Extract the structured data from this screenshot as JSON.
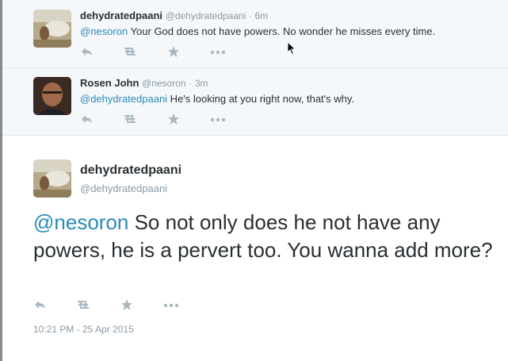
{
  "replies": [
    {
      "fullname": "dehydratedpaani",
      "username": "@dehydratedpaani",
      "time": "6m",
      "mention": "@nesoron",
      "text": " Your God does not have powers. No wonder he misses every time."
    },
    {
      "fullname": "Rosen John",
      "username": "@nesoron",
      "time": "3m",
      "mention": "@dehydratedpaani",
      "text": " He's looking at you right now, that's why."
    }
  ],
  "main_tweet": {
    "fullname": "dehydratedpaani",
    "username": "@dehydratedpaani",
    "mention": "@nesoron",
    "text": " So not only does he not have any powers, he is a pervert too. You wanna add more?",
    "timestamp": "10:21 PM - 25 Apr 2015"
  },
  "icons": {
    "reply": "reply-icon",
    "retweet": "retweet-icon",
    "favorite": "star-icon",
    "more": "more-icon"
  },
  "colors": {
    "link": "#2a8ab8",
    "muted": "#8899a6",
    "icon": "#aab8c2",
    "reply_bg": "#f5f8fa"
  }
}
